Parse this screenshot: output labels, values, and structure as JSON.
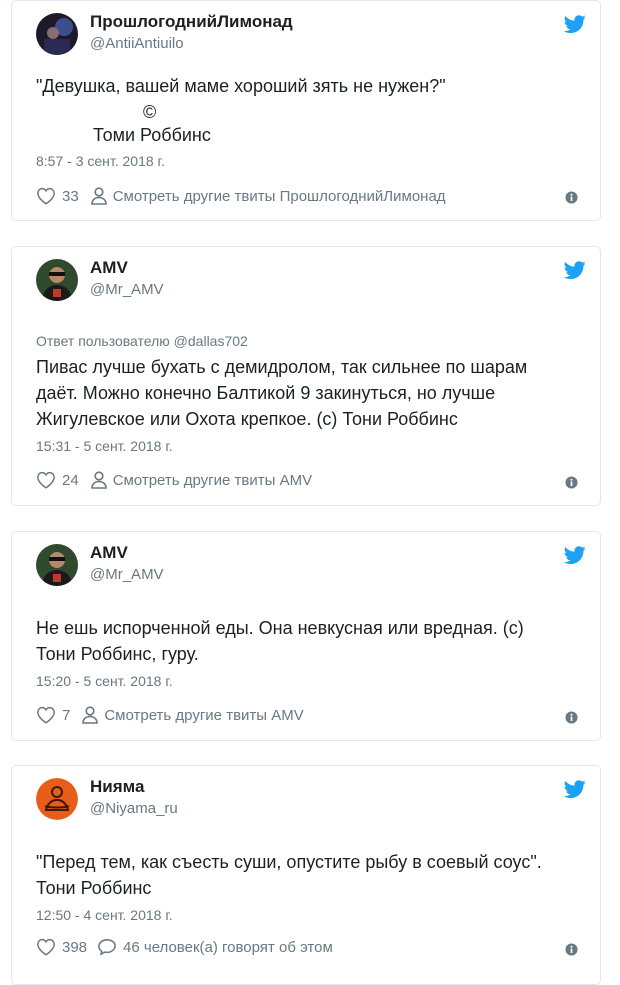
{
  "colors": {
    "twitter_blue": "#1da1f2",
    "muted": "#697882",
    "text": "#1c2022",
    "border": "#e1e8ed"
  },
  "icons": {
    "brand": "twitter-bird-icon",
    "like": "heart-icon",
    "more_tweets": "person-icon",
    "comments": "speech-bubble-icon",
    "info": "info-icon"
  },
  "tweets": [
    {
      "name": "ПрошлогоднийЛимонад",
      "handle": "@AntiiAntiuilo",
      "text": "\"Девушка, вашей маме хороший зять не нужен?\"",
      "sig_symbol": "©",
      "sig_name": "Томи Роббинс",
      "time": "8:57 - 3 сент. 2018 г.",
      "likes": "33",
      "secondary": "Смотреть другие твиты ПрошлогоднийЛимонад"
    },
    {
      "name": "AMV",
      "handle": "@Mr_AMV",
      "reply_to": "Ответ пользователю @dallas702",
      "text": "Пивас лучше бухать с демидролом, так сильнее по шарам\nдаёт. Можно конечно Балтикой 9 закинуться, но лучше\nЖигулевское или Охота крепкое. (с) Тони Роббинс",
      "time": "15:31 - 5 сент. 2018 г.",
      "likes": "24",
      "secondary": "Смотреть другие твиты AMV"
    },
    {
      "name": "AMV",
      "handle": "@Mr_AMV",
      "text": "Не ешь испорченной еды. Она невкусная или вредная. (с)\nТони Роббинс, гуру.",
      "time": "15:20 - 5 сент. 2018 г.",
      "likes": "7",
      "secondary": "Смотреть другие твиты AMV"
    },
    {
      "name": "Нияма",
      "handle": "@Niyama_ru",
      "text": "\"Перед тем, как съесть суши, опустите рыбу в соевый соус\".\nТони Роббинс",
      "time": "12:50 - 4 сент. 2018 г.",
      "likes": "398",
      "secondary": "46 человек(а) говорят об этом"
    }
  ]
}
